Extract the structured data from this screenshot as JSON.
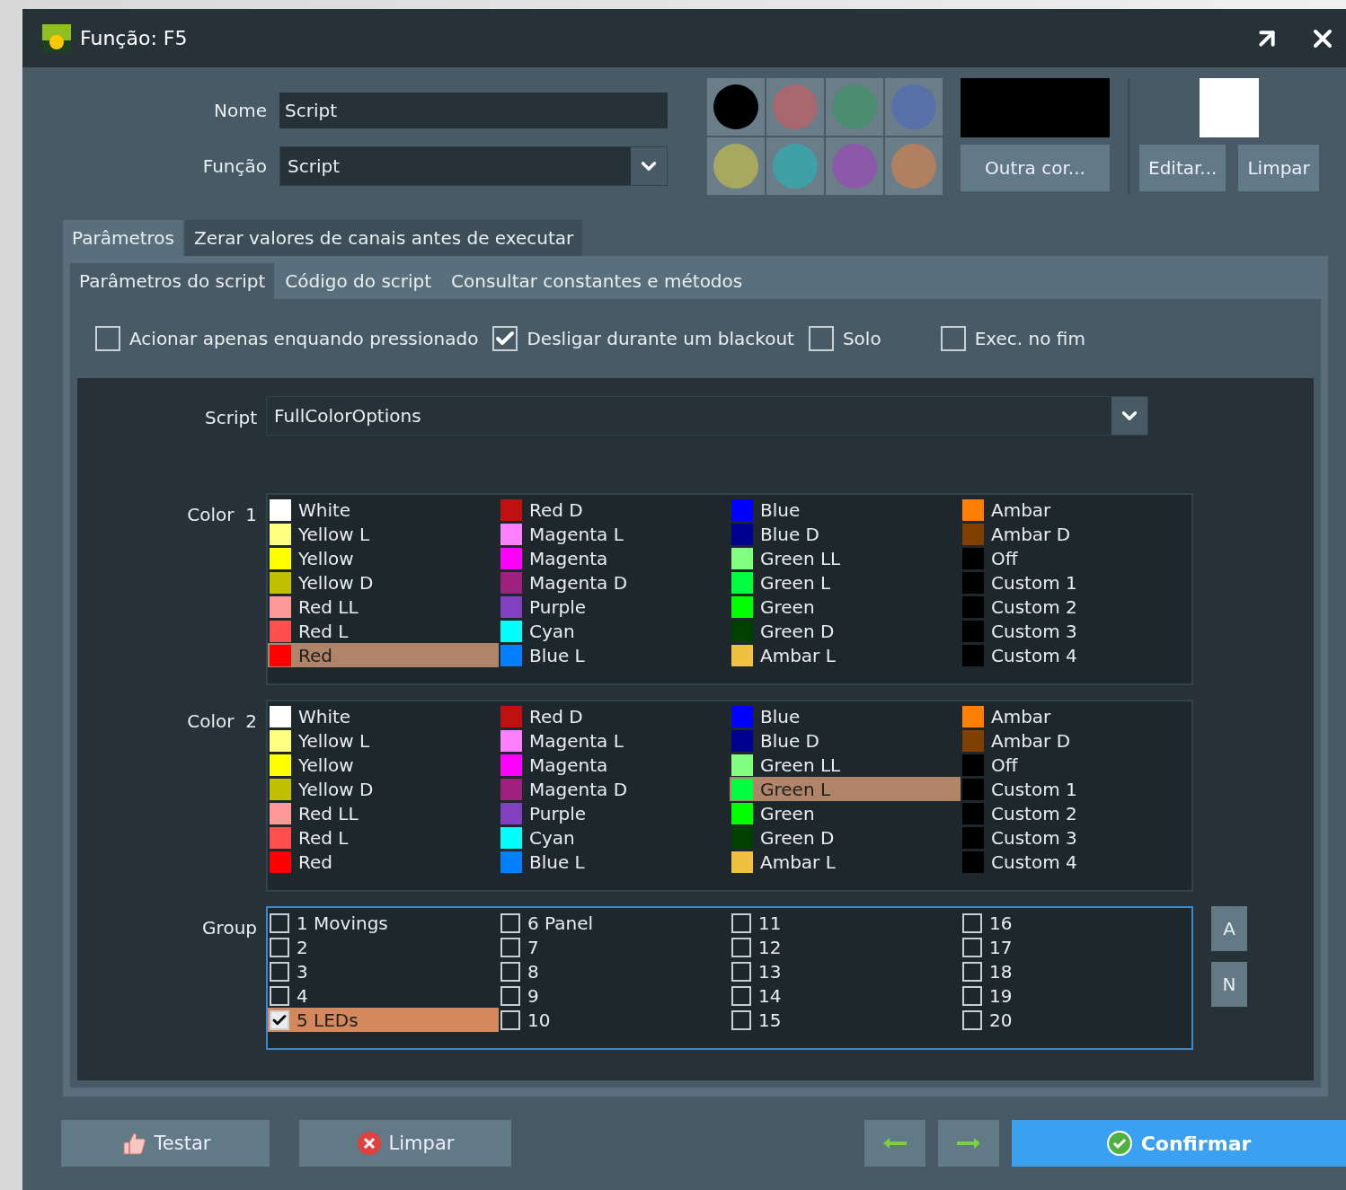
{
  "window": {
    "title": "Função: F5"
  },
  "form": {
    "name_label": "Nome",
    "name_value": "Script",
    "function_label": "Função",
    "function_value": "Script"
  },
  "swatches": [
    {
      "color": "#000000"
    },
    {
      "color": "#a86870"
    },
    {
      "color": "#4c8c70"
    },
    {
      "color": "#5870a8"
    },
    {
      "color": "#a8a860"
    },
    {
      "color": "#40a0a8"
    },
    {
      "color": "#8c58a8"
    },
    {
      "color": "#b08060"
    }
  ],
  "current_color": {
    "color": "#000000",
    "button": "Outra cor..."
  },
  "image": {
    "color": "#ffffff",
    "edit_button": "Editar...",
    "clear_button": "Limpar"
  },
  "outer_tabs": [
    {
      "label": "Parâmetros",
      "selected": true
    },
    {
      "label": "Zerar valores de canais antes de executar",
      "selected": false
    }
  ],
  "inner_tabs": [
    {
      "label": "Parâmetros do script",
      "selected": true
    },
    {
      "label": "Código do script",
      "selected": false
    },
    {
      "label": "Consultar constantes e métodos",
      "selected": false
    }
  ],
  "options": [
    {
      "label": "Acionar apenas enquando pressionado",
      "checked": false
    },
    {
      "label": "Desligar durante um blackout",
      "checked": true
    },
    {
      "label": "Solo",
      "checked": false
    },
    {
      "label": "Exec. no fim",
      "checked": false
    }
  ],
  "script": {
    "label": "Script",
    "value": "FullColorOptions"
  },
  "color_lists": [
    {
      "label": "Color  1",
      "items": [
        {
          "name": "White",
          "color": "#ffffff",
          "selected": false
        },
        {
          "name": "Yellow L",
          "color": "#ffff80",
          "selected": false
        },
        {
          "name": "Yellow",
          "color": "#ffff00",
          "selected": false
        },
        {
          "name": "Yellow D",
          "color": "#c0c000",
          "selected": false
        },
        {
          "name": "Red LL",
          "color": "#ff9999",
          "selected": false
        },
        {
          "name": "Red L",
          "color": "#ff5050",
          "selected": false
        },
        {
          "name": "Red",
          "color": "#ff0000",
          "selected": true
        },
        {
          "name": "Red D",
          "color": "#c01010",
          "selected": false
        },
        {
          "name": "Magenta L",
          "color": "#ff80ff",
          "selected": false
        },
        {
          "name": "Magenta",
          "color": "#ff00ff",
          "selected": false
        },
        {
          "name": "Magenta D",
          "color": "#a02080",
          "selected": false
        },
        {
          "name": "Purple",
          "color": "#8040c0",
          "selected": false
        },
        {
          "name": "Cyan",
          "color": "#00ffff",
          "selected": false
        },
        {
          "name": "Blue L",
          "color": "#0080ff",
          "selected": false
        },
        {
          "name": "Blue",
          "color": "#0000ff",
          "selected": false
        },
        {
          "name": "Blue D",
          "color": "#000090",
          "selected": false
        },
        {
          "name": "Green LL",
          "color": "#80ff80",
          "selected": false
        },
        {
          "name": "Green L",
          "color": "#00ff40",
          "selected": false
        },
        {
          "name": "Green",
          "color": "#00ff00",
          "selected": false
        },
        {
          "name": "Green D",
          "color": "#004000",
          "selected": false
        },
        {
          "name": "Ambar L",
          "color": "#f0c040",
          "selected": false
        },
        {
          "name": "Ambar",
          "color": "#ff8000",
          "selected": false
        },
        {
          "name": "Ambar D",
          "color": "#804000",
          "selected": false
        },
        {
          "name": "Off",
          "color": "#000000",
          "selected": false
        },
        {
          "name": "Custom 1",
          "color": "#000000",
          "selected": false
        },
        {
          "name": "Custom 2",
          "color": "#000000",
          "selected": false
        },
        {
          "name": "Custom 3",
          "color": "#000000",
          "selected": false
        },
        {
          "name": "Custom 4",
          "color": "#000000",
          "selected": false
        }
      ]
    },
    {
      "label": "Color  2",
      "items": [
        {
          "name": "White",
          "color": "#ffffff",
          "selected": false
        },
        {
          "name": "Yellow L",
          "color": "#ffff80",
          "selected": false
        },
        {
          "name": "Yellow",
          "color": "#ffff00",
          "selected": false
        },
        {
          "name": "Yellow D",
          "color": "#c0c000",
          "selected": false
        },
        {
          "name": "Red LL",
          "color": "#ff9999",
          "selected": false
        },
        {
          "name": "Red L",
          "color": "#ff5050",
          "selected": false
        },
        {
          "name": "Red",
          "color": "#ff0000",
          "selected": false
        },
        {
          "name": "Red D",
          "color": "#c01010",
          "selected": false
        },
        {
          "name": "Magenta L",
          "color": "#ff80ff",
          "selected": false
        },
        {
          "name": "Magenta",
          "color": "#ff00ff",
          "selected": false
        },
        {
          "name": "Magenta D",
          "color": "#a02080",
          "selected": false
        },
        {
          "name": "Purple",
          "color": "#8040c0",
          "selected": false
        },
        {
          "name": "Cyan",
          "color": "#00ffff",
          "selected": false
        },
        {
          "name": "Blue L",
          "color": "#0080ff",
          "selected": false
        },
        {
          "name": "Blue",
          "color": "#0000ff",
          "selected": false
        },
        {
          "name": "Blue D",
          "color": "#000090",
          "selected": false
        },
        {
          "name": "Green LL",
          "color": "#80ff80",
          "selected": false
        },
        {
          "name": "Green L",
          "color": "#00ff40",
          "selected": true
        },
        {
          "name": "Green",
          "color": "#00ff00",
          "selected": false
        },
        {
          "name": "Green D",
          "color": "#004000",
          "selected": false
        },
        {
          "name": "Ambar L",
          "color": "#f0c040",
          "selected": false
        },
        {
          "name": "Ambar",
          "color": "#ff8000",
          "selected": false
        },
        {
          "name": "Ambar D",
          "color": "#804000",
          "selected": false
        },
        {
          "name": "Off",
          "color": "#000000",
          "selected": false
        },
        {
          "name": "Custom 1",
          "color": "#000000",
          "selected": false
        },
        {
          "name": "Custom 2",
          "color": "#000000",
          "selected": false
        },
        {
          "name": "Custom 3",
          "color": "#000000",
          "selected": false
        },
        {
          "name": "Custom 4",
          "color": "#000000",
          "selected": false
        }
      ]
    }
  ],
  "group": {
    "label": "Group",
    "items": [
      {
        "name": "1 Movings",
        "checked": false,
        "selected": false
      },
      {
        "name": "2",
        "checked": false,
        "selected": false
      },
      {
        "name": "3",
        "checked": false,
        "selected": false
      },
      {
        "name": "4",
        "checked": false,
        "selected": false
      },
      {
        "name": "5 LEDs",
        "checked": true,
        "selected": true
      },
      {
        "name": "6 Panel",
        "checked": false,
        "selected": false
      },
      {
        "name": "7",
        "checked": false,
        "selected": false
      },
      {
        "name": "8",
        "checked": false,
        "selected": false
      },
      {
        "name": "9",
        "checked": false,
        "selected": false
      },
      {
        "name": "10",
        "checked": false,
        "selected": false
      },
      {
        "name": "11",
        "checked": false,
        "selected": false
      },
      {
        "name": "12",
        "checked": false,
        "selected": false
      },
      {
        "name": "13",
        "checked": false,
        "selected": false
      },
      {
        "name": "14",
        "checked": false,
        "selected": false
      },
      {
        "name": "15",
        "checked": false,
        "selected": false
      },
      {
        "name": "16",
        "checked": false,
        "selected": false
      },
      {
        "name": "17",
        "checked": false,
        "selected": false
      },
      {
        "name": "18",
        "checked": false,
        "selected": false
      },
      {
        "name": "19",
        "checked": false,
        "selected": false
      },
      {
        "name": "20",
        "checked": false,
        "selected": false
      }
    ],
    "buttons": [
      "A",
      "N"
    ]
  },
  "footer": {
    "test_button": "Testar",
    "clear_button": "Limpar",
    "confirm_button": "Confirmar"
  }
}
